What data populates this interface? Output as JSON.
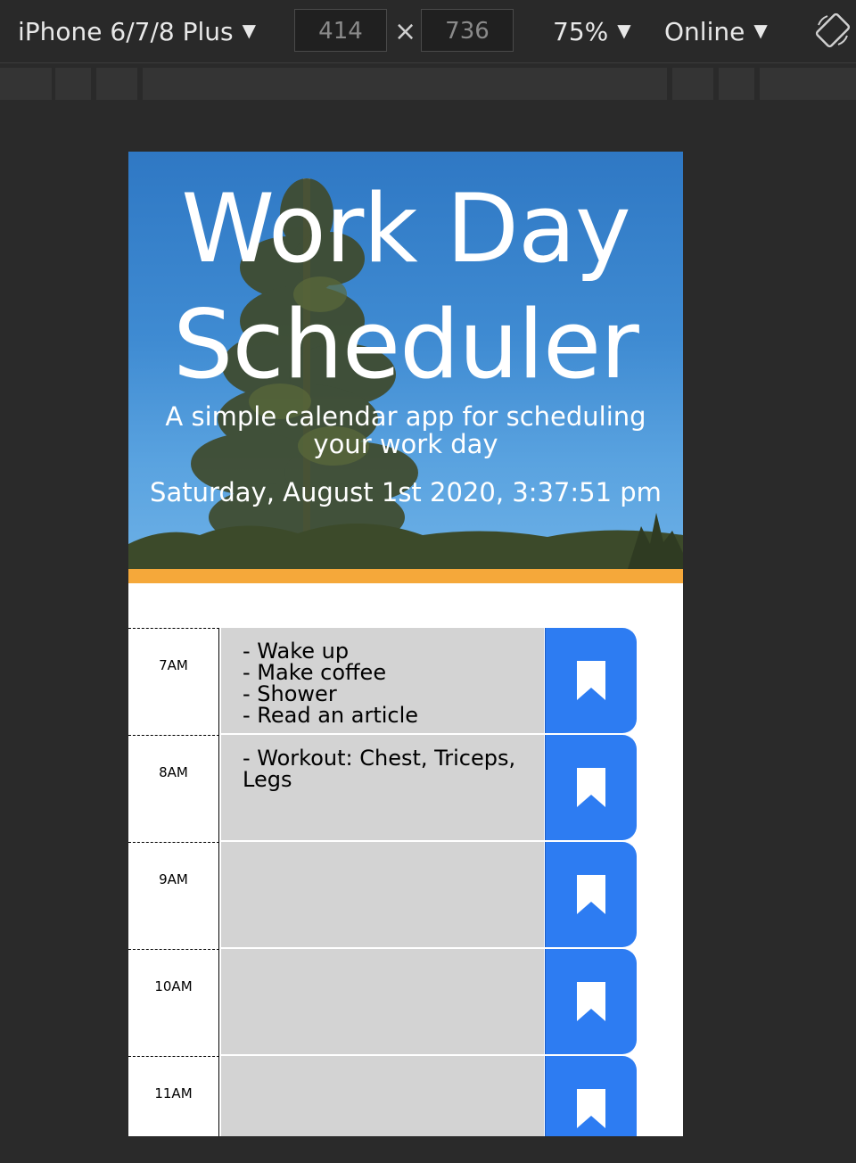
{
  "toolbar": {
    "device": "iPhone 6/7/8 Plus",
    "width": "414",
    "height": "736",
    "zoom": "75%",
    "network": "Online",
    "times_symbol": "×"
  },
  "app": {
    "title_line1": "Work Day",
    "title_line2": "Scheduler",
    "subtitle": "A simple calendar app for scheduling your work day",
    "current_datetime": "Saturday, August 1st 2020, 3:37:51 pm",
    "colors": {
      "accent_stripe": "#f5a83a",
      "save_button": "#2d7cf2",
      "time_block": "#d3d3d3"
    }
  },
  "time_blocks": [
    {
      "hour": "7AM",
      "text": "- Wake up\n- Make coffee\n- Shower\n- Read an article",
      "icon": "bookmark-icon"
    },
    {
      "hour": "8AM",
      "text": "- Workout: Chest, Triceps, Legs",
      "icon": "bookmark-icon"
    },
    {
      "hour": "9AM",
      "text": "",
      "icon": "bookmark-icon"
    },
    {
      "hour": "10AM",
      "text": "",
      "icon": "bookmark-icon"
    },
    {
      "hour": "11AM",
      "text": "",
      "icon": "bookmark-icon"
    }
  ]
}
